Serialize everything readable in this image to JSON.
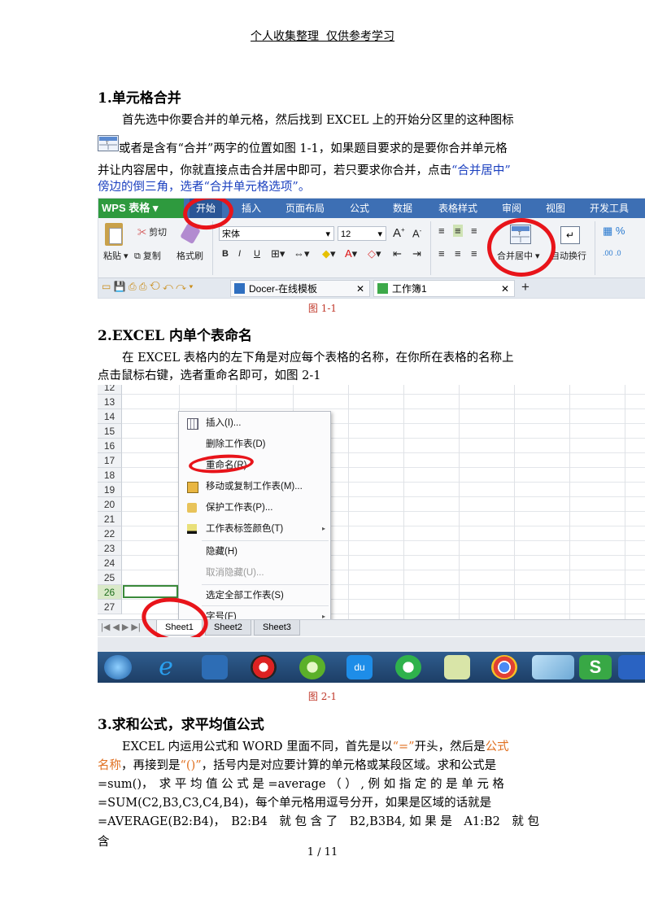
{
  "header": "个人收集整理  仅供参考学习",
  "sections": [
    {
      "title": "1.单元格合并",
      "p1": "首先选中你要合并的单元格，然后找到 EXCEL 上的开始分区里的这种图标",
      "p2": "或者是含有“合并”两字的位置如图 1-1，如果题目要求的是要你合并单元格",
      "p3a": "并让内容居中，你就直接点击合并居中即可，若只要求你合并，点击",
      "p3b": "“合并居中”",
      "p4": "傍边的倒三角，选者“合并单元格选项”。",
      "caption": "图 1-1"
    },
    {
      "title": "2.EXCEL 内单个表命名",
      "p1": "在 EXCEL 表格内的左下角是对应每个表格的名称，在你所在表格的名称上",
      "p2": "点击鼠标右键，选者重命名即可，如图 2-1",
      "caption": "图 2-1"
    },
    {
      "title": "3.求和公式，求平均值公式",
      "p1a": "EXCEL 内运用公式和 WORD 里面不同，首先是以",
      "p1b": "“=”",
      "p1c": "开头，然后是",
      "p1d": "公式",
      "p2a": "名称",
      "p2b": "，再接到是",
      "p2c": "“()”",
      "p2d": "，括号内是对应要计算的单元格或某段区域。求和公式是",
      "p3": "=sum()，　求 平 均 值 公 式 是 =average （ ） , 例 如 指 定 的 是 单 元 格",
      "p4": "=SUM(C2,B3,C3,C4,B4)，每个单元格用逗号分开，如果是区域的话就是",
      "p5": "=AVERAGE(B2:B4)，　B2:B4　就 包 含 了　B2,B3B4, 如 果 是　A1:B2　就 包 含"
    }
  ],
  "ribbon": {
    "logo": "WPS 表格",
    "tabs": [
      "开始",
      "插入",
      "页面布局",
      "公式",
      "数据",
      "表格样式",
      "审阅",
      "视图",
      "开发工具"
    ],
    "cut": "剪切",
    "paste": "粘贴",
    "copy": "复制",
    "format_painter": "格式刷",
    "font_name": "宋体",
    "font_size": "12",
    "merge_center": "合并居中",
    "wrap": "自动换行",
    "doc_tab1": "Docer-在线模板",
    "doc_tab2": "工作簿1"
  },
  "sheet": {
    "rows": [
      "12",
      "13",
      "14",
      "15",
      "16",
      "17",
      "18",
      "19",
      "20",
      "21",
      "22",
      "23",
      "24",
      "25",
      "26",
      "27"
    ],
    "menu": [
      {
        "label": "插入(I)...",
        "icon": "insert-sheet-icon"
      },
      {
        "label": "删除工作表(D)"
      },
      {
        "label": "重命名(R)"
      },
      {
        "label": "移动或复制工作表(M)...",
        "icon": "move-copy-icon"
      },
      {
        "label": "保护工作表(P)...",
        "icon": "lock-icon"
      },
      {
        "label": "工作表标签颜色(T)",
        "icon": "tab-color-icon",
        "submenu": true
      },
      {
        "label": "隐藏(H)"
      },
      {
        "label": "取消隐藏(U)...",
        "disabled": true
      },
      {
        "label": "选定全部工作表(S)"
      },
      {
        "label": "字号(F)",
        "submenu": true
      }
    ],
    "tabs": [
      "Sheet1",
      "Sheet2",
      "Sheet3"
    ]
  },
  "footer": "1 / 11"
}
